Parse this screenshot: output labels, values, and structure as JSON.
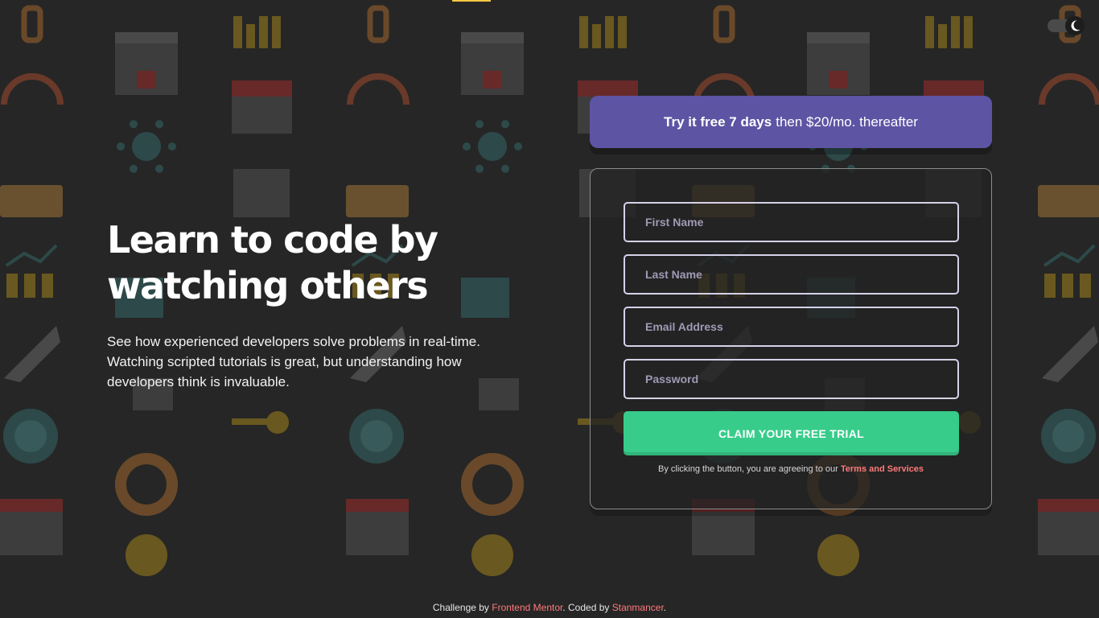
{
  "theme_toggle": {
    "icon": "moon-icon",
    "mode": "dark"
  },
  "hero": {
    "title_line1": "Learn to code by",
    "title_line2": "watching others",
    "description": "See how experienced developers solve problems in real-time. Watching scripted tutorials is great, but understanding how developers think is invaluable."
  },
  "offer": {
    "bold": "Try it free 7 days",
    "rest": "then $20/mo. thereafter"
  },
  "form": {
    "first_name_placeholder": "First Name",
    "last_name_placeholder": "Last Name",
    "email_placeholder": "Email Address",
    "password_placeholder": "Password",
    "submit_label": "CLAIM YOUR FREE TRIAL",
    "terms_prefix": "By clicking the button, you are agreeing to our",
    "terms_link": "Terms and Services"
  },
  "footer": {
    "prefix": "Challenge by",
    "challenge_link": "Frontend Mentor",
    "middle": ". Coded by",
    "author_link": "Stanmancer",
    "suffix": "."
  },
  "colors": {
    "background": "#262626",
    "offer_bg": "#5e54a4",
    "cta_green": "#38cc8b",
    "link_red": "#ff7a7a"
  }
}
